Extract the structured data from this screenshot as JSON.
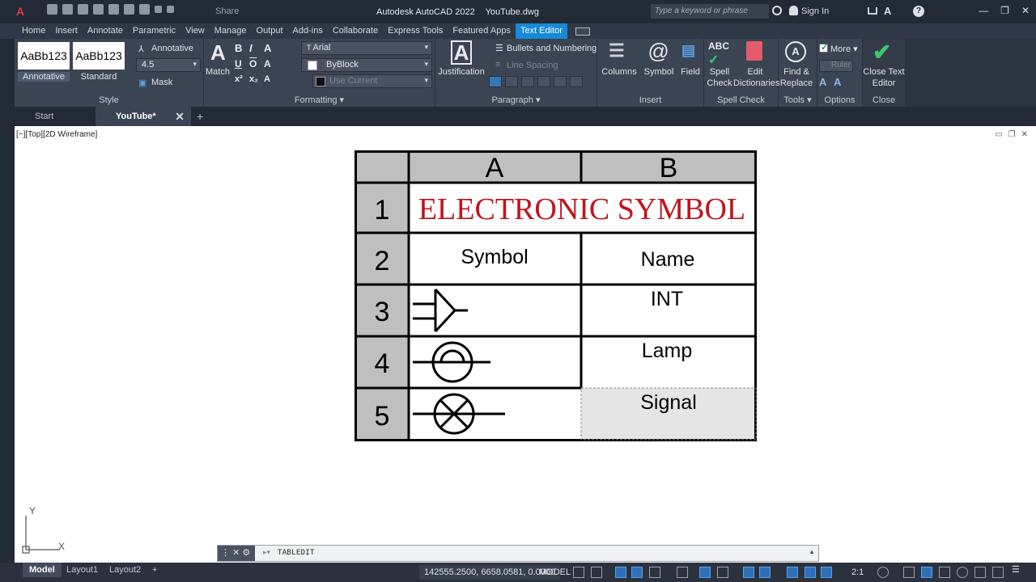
{
  "titlebar": {
    "share_label": "Share",
    "app_title": "Autodesk AutoCAD 2022",
    "file_name": "YouTube.dwg",
    "search_placeholder": "Type a keyword or phrase",
    "sign_in": "Sign In"
  },
  "ribbon_tabs": [
    "Home",
    "Insert",
    "Annotate",
    "Parametric",
    "View",
    "Manage",
    "Output",
    "Add-ins",
    "Collaborate",
    "Express Tools",
    "Featured Apps",
    "Text Editor"
  ],
  "ribbon": {
    "style": {
      "tile_annotative": "AaBb123",
      "tile_standard": "AaBb123",
      "cap_annotative": "Annotative",
      "cap_standard": "Standard",
      "annotative_label": "Annotative",
      "height_value": "4.5",
      "mask_label": "Mask",
      "panel_label": "Style"
    },
    "formatting": {
      "match_label": "Match",
      "font_value": "Arial",
      "color_value": "ByBlock",
      "bg_value": "Use Current",
      "panel_label": "Formatting"
    },
    "paragraph": {
      "justification_label": "Justification",
      "bullets_label": "Bullets and Numbering",
      "line_spacing_label": "Line Spacing",
      "panel_label": "Paragraph"
    },
    "insert": {
      "columns_label": "Columns",
      "symbol_label": "Symbol",
      "field_label": "Field",
      "panel_label": "Insert"
    },
    "spell": {
      "spell_check_label": "Spell Check",
      "edit_dict_label": "Edit Dictionaries",
      "panel_label": "Spell Check"
    },
    "tools": {
      "find_replace_label": "Find & Replace",
      "panel_label": "Tools"
    },
    "options": {
      "more_label": "More",
      "ruler_label": "Ruler",
      "panel_label": "Options"
    },
    "close": {
      "close_label": "Close Text Editor",
      "panel_label": "Close"
    }
  },
  "doc_tabs": {
    "start": "Start",
    "youtube": "YouTube*"
  },
  "viewport": {
    "label": "[−][Top][2D Wireframe]"
  },
  "table": {
    "col_headers": [
      "A",
      "B"
    ],
    "row_headers": [
      "1",
      "2",
      "3",
      "4",
      "5"
    ],
    "title": "ELECTRONIC SYMBOL",
    "header_symbol": "Symbol",
    "header_name": "Name",
    "names": [
      "INT",
      "Lamp",
      "Signal"
    ],
    "title_color": "#c0141c",
    "header_fill": "#bfbfbf",
    "selected_cell_fill": "#e5e5e5"
  },
  "ucs": {
    "x_label": "X",
    "y_label": "Y"
  },
  "command": {
    "text": "TABLEDIT"
  },
  "statusbar": {
    "tabs": [
      "Model",
      "Layout1",
      "Layout2"
    ],
    "coords": "142555.2500, 6658.0581, 0.0000",
    "mode": "MODEL",
    "scale": "2:1"
  }
}
